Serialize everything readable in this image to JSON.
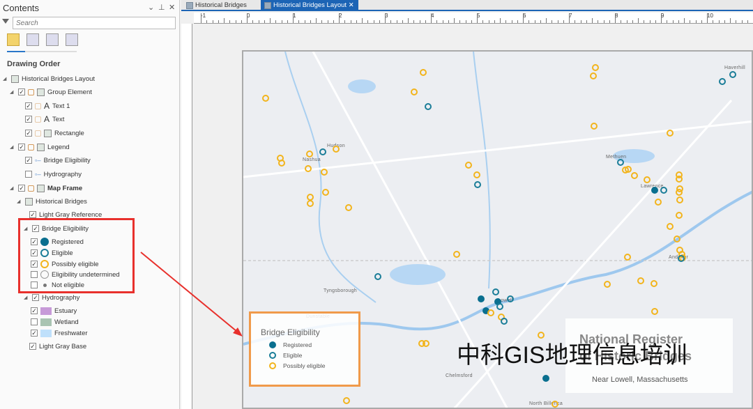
{
  "pane": {
    "title": "Contents",
    "search_placeholder": "Search",
    "section": "Drawing Order",
    "items": [
      {
        "label": "Historical Bridges Layout"
      },
      {
        "label": "Group Element"
      },
      {
        "label": "Text 1"
      },
      {
        "label": "Text"
      },
      {
        "label": "Rectangle"
      },
      {
        "label": "Legend"
      },
      {
        "label": "Bridge Eligibility"
      },
      {
        "label": "Hydrography"
      },
      {
        "label": "Map Frame"
      },
      {
        "label": "Historical Bridges"
      },
      {
        "label": "Light Gray Reference"
      },
      {
        "label": "Bridge Eligibility"
      },
      {
        "label": "Registered"
      },
      {
        "label": "Eligible"
      },
      {
        "label": "Possibly eligible"
      },
      {
        "label": "Eligibility undetermined"
      },
      {
        "label": "Not eligible"
      },
      {
        "label": "Hydrography"
      },
      {
        "label": "Estuary"
      },
      {
        "label": "Wetland"
      },
      {
        "label": "Freshwater"
      },
      {
        "label": "Light Gray Base"
      }
    ]
  },
  "tabs": [
    {
      "label": "Historical Bridges"
    },
    {
      "label": "Historical Bridges Layout"
    }
  ],
  "ruler": {
    "h": [
      "-1",
      "0",
      "1",
      "2",
      "3",
      "4",
      "5",
      "6",
      "7",
      "8",
      "9",
      "10"
    ]
  },
  "map": {
    "places": [
      "Haverhill",
      "Nashua",
      "Hudson",
      "Methuen",
      "Lawrence",
      "Tyngsborough",
      "Lowell",
      "Dunstable",
      "Chelmsford",
      "North Billerica",
      "Andover"
    ]
  },
  "legend": {
    "title": "Bridge Eligibility",
    "items": [
      "Registered",
      "Eligible",
      "Possibly eligible"
    ]
  },
  "titlebox": {
    "line1": "National Register",
    "line2": "of Historic Bridges",
    "subtitle": "Near Lowell, Massachusetts"
  },
  "watermark": "中科GIS地理信息培训",
  "colors": {
    "registered": "#0a6f8f",
    "eligible": "#1a7d98",
    "possibly": "#f2b41c",
    "highlight": "#e8302c",
    "legend_border": "#f09a4a",
    "tab_active": "#1c64b5"
  }
}
